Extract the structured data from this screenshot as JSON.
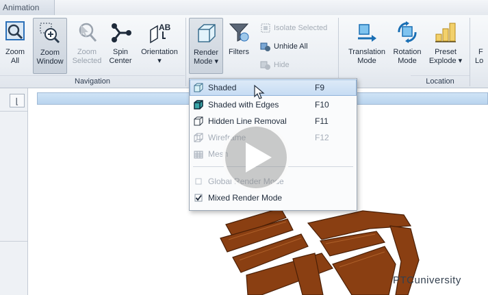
{
  "tab": {
    "label": "Animation"
  },
  "ribbon": {
    "navigation": {
      "label": "Navigation",
      "buttons": [
        {
          "label": "Zoom\nAll",
          "l1": "Zoom",
          "l2": "All"
        },
        {
          "l1": "Zoom",
          "l2": "Window"
        },
        {
          "l1": "Zoom",
          "l2": "Selected"
        },
        {
          "l1": "Spin",
          "l2": "Center"
        },
        {
          "l1": "Orientation",
          "l2": "▾"
        }
      ]
    },
    "render": {
      "render_mode": {
        "l1": "Render",
        "l2": "Mode ▾"
      },
      "filters": {
        "l1": "Filters"
      },
      "isolate_selected": "Isolate Selected",
      "unhide_all": "Unhide All",
      "hide": "Hide"
    },
    "location": {
      "label": "Location",
      "translation_mode": {
        "l1": "Translation",
        "l2": "Mode"
      },
      "rotation_mode": {
        "l1": "Rotation",
        "l2": "Mode"
      },
      "preset_explode": {
        "l1": "Preset",
        "l2": "Explode ▾"
      },
      "cut_off": {
        "l1": "F",
        "l2": "Lo"
      }
    }
  },
  "menu": {
    "items": [
      {
        "label": "Shaded",
        "key": "F9",
        "enabled": true,
        "highlighted": true
      },
      {
        "label": "Shaded with Edges",
        "key": "F10",
        "enabled": true
      },
      {
        "label": "Hidden Line Removal",
        "key": "F11",
        "enabled": true
      },
      {
        "label": "Wireframe",
        "key": "F12",
        "enabled": false
      },
      {
        "label": "Mesh",
        "key": "",
        "enabled": false
      }
    ],
    "checks": [
      {
        "label": "Global Render Mode",
        "checked": false,
        "enabled": false
      },
      {
        "label": "Mixed Render Mode",
        "checked": true,
        "enabled": true
      }
    ]
  },
  "side": {
    "button_glyph": "⌊"
  },
  "brand": {
    "text": "PTCuniversity"
  },
  "colors": {
    "accent": "#1a7fd4",
    "chair": "#8a3f12",
    "menu_highlight": "#c7dcf3"
  }
}
